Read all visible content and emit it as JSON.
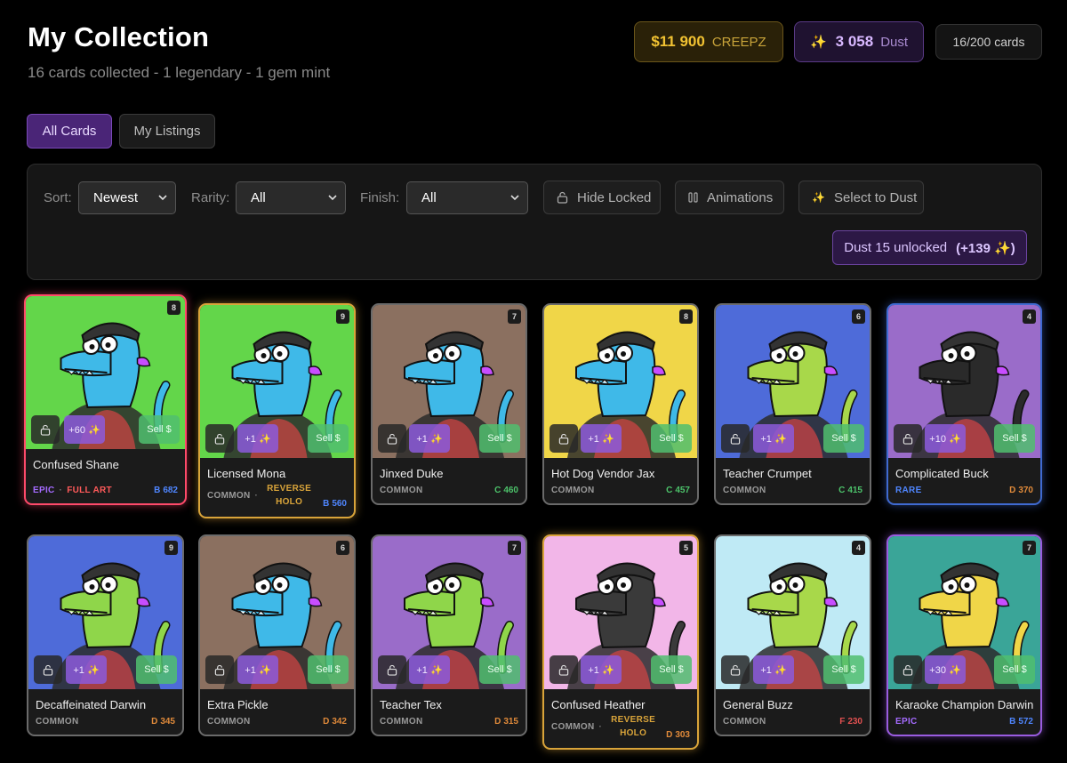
{
  "header": {
    "title": "My Collection",
    "subtitle": "16 cards collected - 1 legendary - 1 gem mint"
  },
  "wallet": {
    "creepz_amount": "$11 900",
    "creepz_unit": "CREEPZ",
    "dust_amount": "3 058",
    "dust_unit": "Dust",
    "cards_count": "16/200 cards"
  },
  "tabs": [
    {
      "label": "All Cards",
      "active": true
    },
    {
      "label": "My Listings",
      "active": false
    }
  ],
  "filters": {
    "sort_label": "Sort:",
    "sort_value": "Newest",
    "rarity_label": "Rarity:",
    "rarity_value": "All",
    "finish_label": "Finish:",
    "finish_value": "All",
    "hide_locked": "Hide Locked",
    "animations": "Animations",
    "select_to_dust": "Select to Dust",
    "dust_unlocked": "Dust 15 unlocked",
    "dust_unlocked_bonus": "(+139 ✨)"
  },
  "colors": {
    "accent_purple": "#4a2577",
    "creepz_gold": "#f1c232",
    "epic": "#a56bff",
    "rare": "#4f86ff",
    "full_art": "#ff5a5a",
    "reverse_holo": "#d9a43a"
  },
  "cards": [
    {
      "name": "Confused Shane",
      "badge": "8",
      "dust": "+60 ✨",
      "sell": "Sell $",
      "rarity": "EPIC",
      "rarity_class": "r-epic",
      "finish": "FULL ART",
      "grade_letter": "B",
      "grade_num": "682",
      "bg": "#63d64a",
      "skin": "#3fb9e8",
      "border": "#ff4a6a"
    },
    {
      "name": "Licensed Mona",
      "badge": "9",
      "dust": "+1 ✨",
      "sell": "Sell $",
      "rarity": "COMMON",
      "rarity_class": "r-common",
      "finish": "REVERSE HOLO",
      "grade_letter": "B",
      "grade_num": "560",
      "bg": "#63d64a",
      "skin": "#3fb9e8",
      "border": "#d9a43a"
    },
    {
      "name": "Jinxed Duke",
      "badge": "7",
      "dust": "+1 ✨",
      "sell": "Sell $",
      "rarity": "COMMON",
      "rarity_class": "r-common",
      "finish": "",
      "grade_letter": "C",
      "grade_num": "460",
      "bg": "#8b7060",
      "skin": "#3fb9e8",
      "border": "#6a6a6a"
    },
    {
      "name": "Hot Dog Vendor Jax",
      "badge": "8",
      "dust": "+1 ✨",
      "sell": "Sell $",
      "rarity": "COMMON",
      "rarity_class": "r-common",
      "finish": "",
      "grade_letter": "C",
      "grade_num": "457",
      "bg": "#f0d648",
      "skin": "#3fb9e8",
      "border": "#6a6a6a"
    },
    {
      "name": "Teacher Crumpet",
      "badge": "6",
      "dust": "+1 ✨",
      "sell": "Sell $",
      "rarity": "COMMON",
      "rarity_class": "r-common",
      "finish": "",
      "grade_letter": "C",
      "grade_num": "415",
      "bg": "#4e6bd9",
      "skin": "#a8d84a",
      "border": "#6a6a6a"
    },
    {
      "name": "Complicated Buck",
      "badge": "4",
      "dust": "+10 ✨",
      "sell": "Sell $",
      "rarity": "RARE",
      "rarity_class": "r-rare",
      "finish": "",
      "grade_letter": "D",
      "grade_num": "370",
      "bg": "#9a6cc9",
      "skin": "#2a2a2a",
      "border": "#3f6ad1"
    },
    {
      "name": "Decaffeinated Darwin",
      "badge": "9",
      "dust": "+1 ✨",
      "sell": "Sell $",
      "rarity": "COMMON",
      "rarity_class": "r-common",
      "finish": "",
      "grade_letter": "D",
      "grade_num": "345",
      "bg": "#4e6bd9",
      "skin": "#8fd64a",
      "border": "#6a6a6a"
    },
    {
      "name": "Extra Pickle",
      "badge": "6",
      "dust": "+1 ✨",
      "sell": "Sell $",
      "rarity": "COMMON",
      "rarity_class": "r-common",
      "finish": "",
      "grade_letter": "D",
      "grade_num": "342",
      "bg": "#8b7060",
      "skin": "#3fb9e8",
      "border": "#6a6a6a"
    },
    {
      "name": "Teacher Tex",
      "badge": "7",
      "dust": "+1 ✨",
      "sell": "Sell $",
      "rarity": "COMMON",
      "rarity_class": "r-common",
      "finish": "",
      "grade_letter": "D",
      "grade_num": "315",
      "bg": "#9a6cc9",
      "skin": "#8fd64a",
      "border": "#6a6a6a"
    },
    {
      "name": "Confused Heather",
      "badge": "5",
      "dust": "+1 ✨",
      "sell": "Sell $",
      "rarity": "COMMON",
      "rarity_class": "r-common",
      "finish": "REVERSE HOLO",
      "grade_letter": "D",
      "grade_num": "303",
      "bg": "#f2b6e8",
      "skin": "#3a3a3a",
      "border": "#d9a43a"
    },
    {
      "name": "General Buzz",
      "badge": "4",
      "dust": "+1 ✨",
      "sell": "Sell $",
      "rarity": "COMMON",
      "rarity_class": "r-common",
      "finish": "",
      "grade_letter": "F",
      "grade_num": "230",
      "bg": "#bfeaf5",
      "skin": "#a8d84a",
      "border": "#6a6a6a"
    },
    {
      "name": "Karaoke Champion Darwin",
      "badge": "7",
      "dust": "+30 ✨",
      "sell": "Sell $",
      "rarity": "EPIC",
      "rarity_class": "r-epic",
      "finish": "",
      "grade_letter": "B",
      "grade_num": "572",
      "bg": "#3aa598",
      "skin": "#f0d648",
      "border": "#9a5ce0"
    }
  ]
}
